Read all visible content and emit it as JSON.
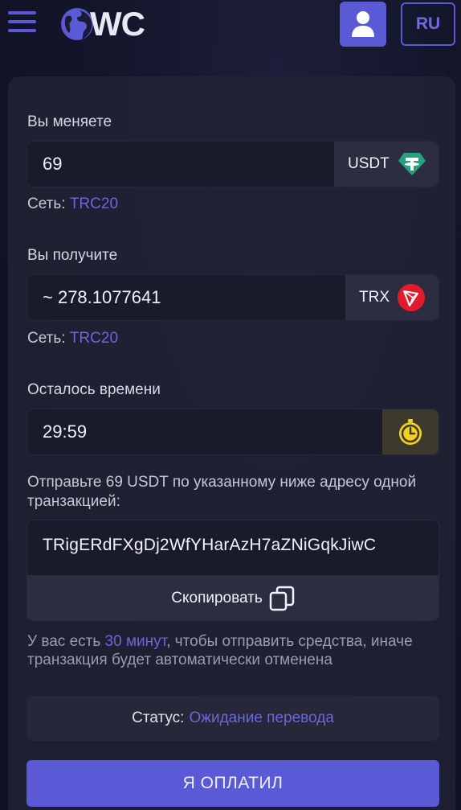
{
  "header": {
    "logo_text": "WC",
    "lang_label": "RU"
  },
  "exchange": {
    "give_label": "Вы меняете",
    "give_value": "69",
    "give_currency": "USDT",
    "give_network_label": "Сеть:",
    "give_network": "TRC20",
    "get_label": "Вы получите",
    "get_value": "~ 278.1077641",
    "get_currency": "TRX",
    "get_network_label": "Сеть:",
    "get_network": "TRC20"
  },
  "timer": {
    "label": "Осталось времени",
    "value": "29:59"
  },
  "instruction": "Отправьте 69 USDT по указанному ниже адресу одной транзакцией:",
  "address": {
    "value": "TRigERdFXgDj2WfYHarAzH7aZNiGqkJiwC",
    "copy_label": "Скопировать"
  },
  "note": {
    "prefix": "У вас есть ",
    "highlight": "30 минут",
    "suffix": ", чтобы отправить средства, иначе транзакция будет автоматически отменена"
  },
  "status": {
    "label": "Статус:",
    "value": "Ожидание перевода"
  },
  "pay_button": "Я ОПЛАТИЛ",
  "colors": {
    "accent": "#5b5ad6",
    "tether": "#26a17b",
    "tron": "#e11b2b",
    "timer": "#f3d21c"
  }
}
